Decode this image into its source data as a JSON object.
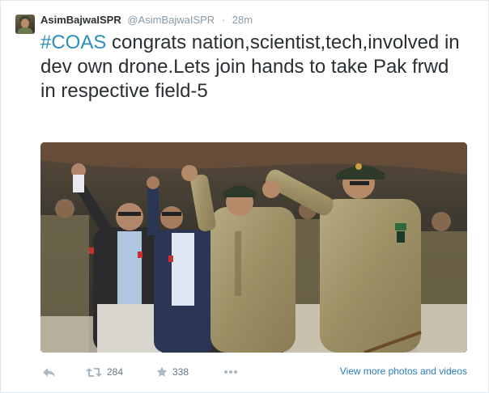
{
  "tweet": {
    "fullname": "AsimBajwaISPR",
    "username": "@AsimBajwaISPR",
    "separator": "·",
    "time": "28m",
    "hashtag": "#COAS",
    "text": " congrats nation,scientist,tech,involved in dev own drone.Lets join hands to take Pak frwd in respective field-5"
  },
  "actions": {
    "reply_icon": "reply-icon",
    "retweet_icon": "retweet-icon",
    "retweet_count": "284",
    "favorite_icon": "star-icon",
    "favorite_count": "338",
    "more_icon": "more-dots-icon",
    "view_more": "View more photos and videos"
  },
  "colors": {
    "hashtag": "#2b8fb8",
    "link": "#2b7bb9",
    "muted": "#8899a6",
    "text": "#292f33"
  }
}
